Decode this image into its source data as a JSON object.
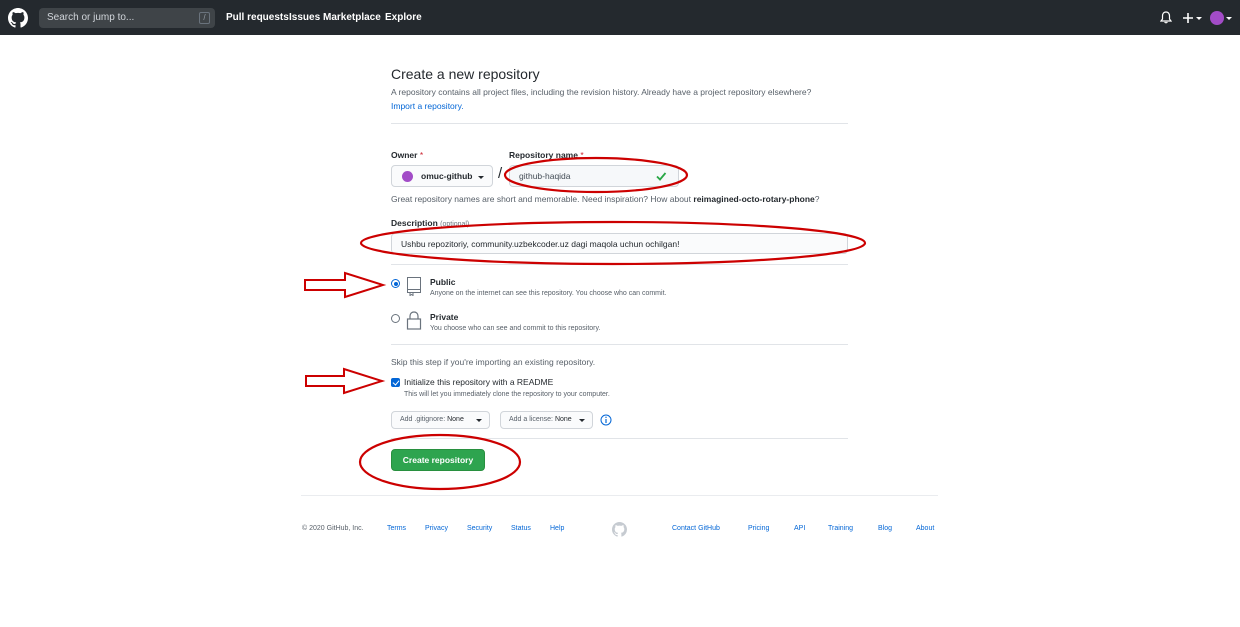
{
  "header": {
    "search_placeholder": "Search or jump to...",
    "search_shortcut": "/",
    "nav": [
      "Pull requests",
      "Issues",
      "Marketplace",
      "Explore"
    ]
  },
  "page": {
    "title": "Create a new repository",
    "subtitle": "A repository contains all project files, including the revision history. Already have a project repository elsewhere?",
    "import_link": "Import a repository."
  },
  "form": {
    "owner_label": "Owner",
    "owner_value": "omuc-github",
    "repo_label": "Repository name",
    "required_mark": "*",
    "separator": "/",
    "repo_value": "github-haqida",
    "hint_prefix": "Great repository names are short and memorable. Need inspiration? How about",
    "hint_suggestion": "reimagined-octo-rotary-phone",
    "hint_suffix": "?",
    "description_label": "Description",
    "description_optional": "(optional)",
    "description_value": "Ushbu repozitoriy, community.uzbekcoder.uz dagi maqola uchun ochilgan!",
    "public_title": "Public",
    "public_desc": "Anyone on the internet can see this repository. You choose who can commit.",
    "private_title": "Private",
    "private_desc": "You choose who can see and commit to this repository.",
    "skip_text": "Skip this step if you're importing an existing repository.",
    "readme_label": "Initialize this repository with a README",
    "readme_desc": "This will let you immediately clone the repository to your computer.",
    "gitignore_prefix": "Add .gitignore:",
    "gitignore_value": "None",
    "license_prefix": "Add a license:",
    "license_value": "None",
    "create_button": "Create repository"
  },
  "footer": {
    "copyright": "© 2020 GitHub, Inc.",
    "left_links": [
      "Terms",
      "Privacy",
      "Security",
      "Status",
      "Help"
    ],
    "right_links": [
      "Contact GitHub",
      "Pricing",
      "API",
      "Training",
      "Blog",
      "About"
    ]
  },
  "colors": {
    "header_bg": "#24292e",
    "link": "#0366d6",
    "primary_button": "#2ea44f",
    "annotation_red": "#cc0000"
  }
}
